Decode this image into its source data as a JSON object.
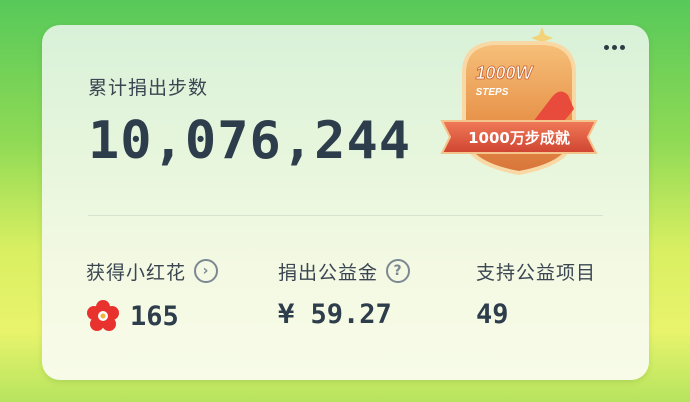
{
  "summary": {
    "total_label": "累计捐出步数",
    "total_value": "10,076,244"
  },
  "badge": {
    "top_text": "1000W",
    "sub_text": "STEPS",
    "ribbon_text": "1000万步成就"
  },
  "stats": {
    "flowers": {
      "label": "获得小红花",
      "value": "165"
    },
    "donated": {
      "label": "捐出公益金",
      "value": "¥ 59.27"
    },
    "projects": {
      "label": "支持公益项目",
      "value": "49"
    }
  },
  "icons": {
    "more": "more-icon",
    "chevron": "chevron-right-icon",
    "help": "question-icon",
    "flower": "red-flower-icon"
  },
  "colors": {
    "text_dark": "#2e3d4c",
    "badge_orange": "#e8934a",
    "ribbon_red": "#e2553d"
  }
}
